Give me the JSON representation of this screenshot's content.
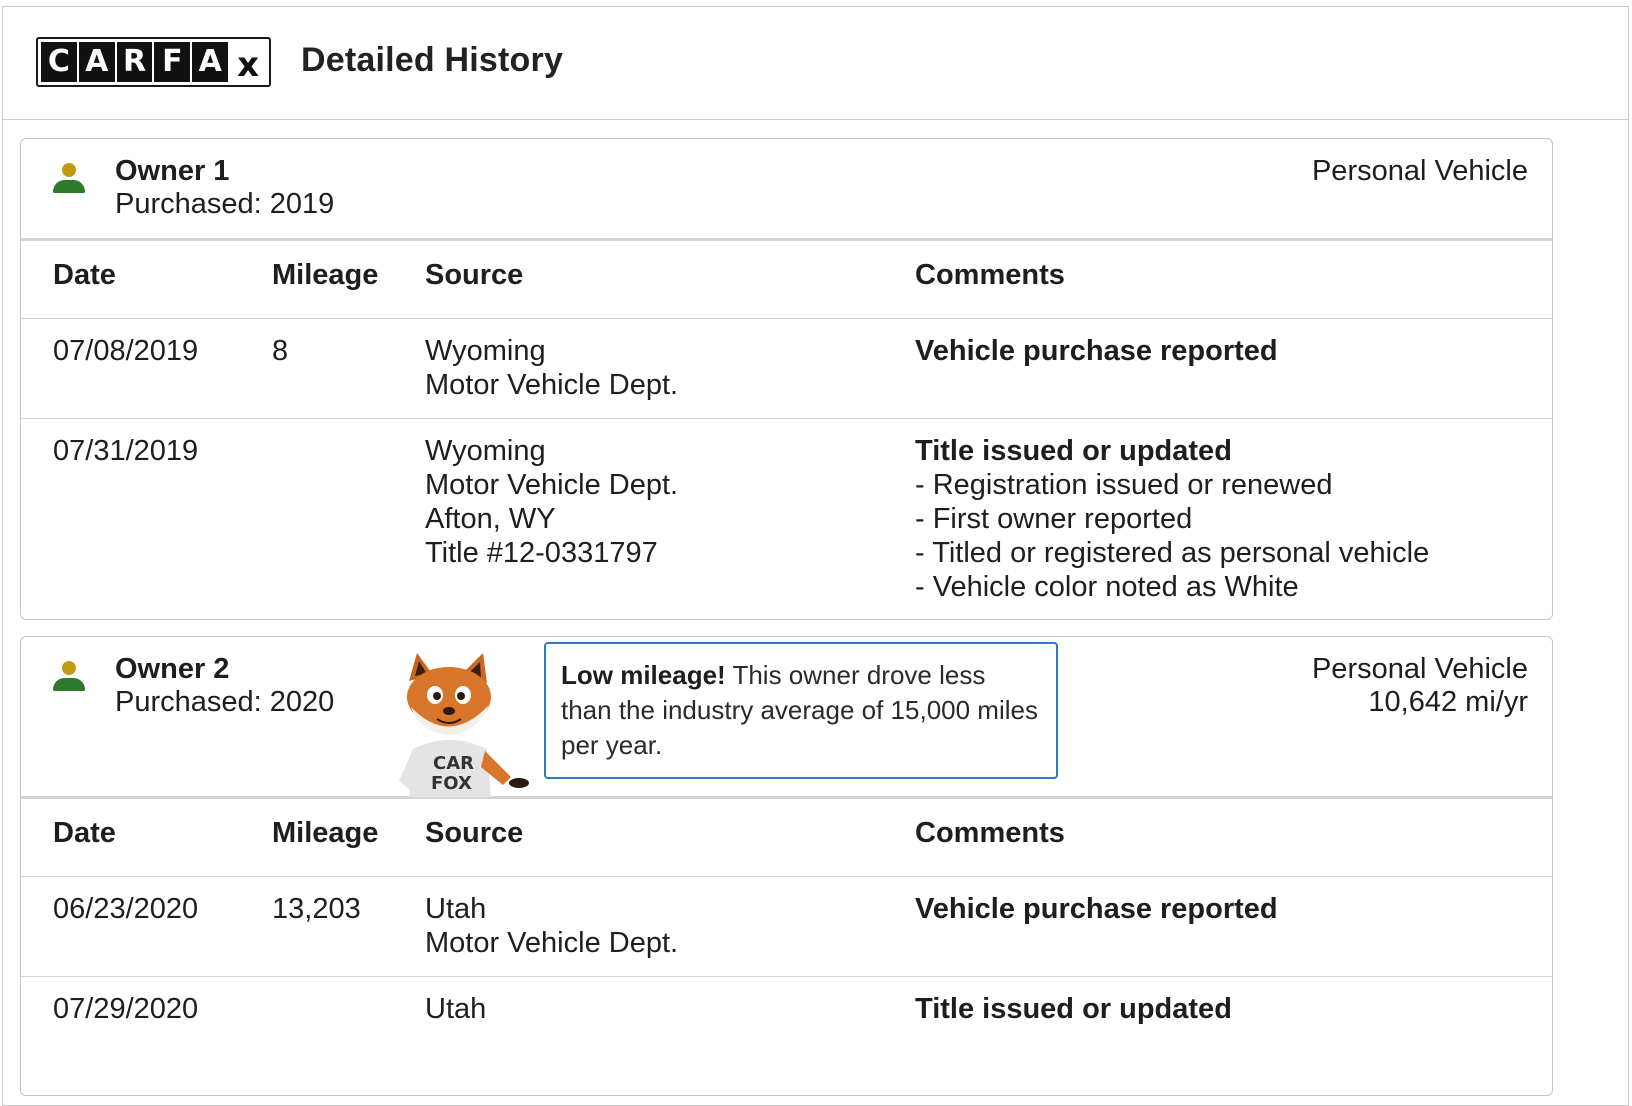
{
  "header": {
    "logo_letters": [
      "C",
      "A",
      "R",
      "F",
      "A",
      "x"
    ],
    "title": "Detailed History"
  },
  "table_headers": {
    "date": "Date",
    "mileage": "Mileage",
    "source": "Source",
    "comments": "Comments"
  },
  "owners": [
    {
      "name": "Owner 1",
      "purchased": "Purchased: 2019",
      "vehicle_type": "Personal Vehicle",
      "rows": [
        {
          "date": "07/08/2019",
          "mileage": "8",
          "source": [
            "Wyoming",
            "Motor Vehicle Dept."
          ],
          "comment_title": "Vehicle purchase reported",
          "comment_items": []
        },
        {
          "date": "07/31/2019",
          "mileage": "",
          "source": [
            "Wyoming",
            "Motor Vehicle Dept.",
            "Afton, WY",
            "Title #12-0331797"
          ],
          "comment_title": "Title issued or updated",
          "comment_items": [
            "- Registration issued or renewed",
            "- First owner reported",
            "- Titled or registered as personal vehicle",
            "- Vehicle color noted as White"
          ]
        }
      ]
    },
    {
      "name": "Owner 2",
      "purchased": "Purchased: 2020",
      "vehicle_type": "Personal Vehicle",
      "miles_per_year": "10,642 mi/yr",
      "callout": {
        "bold": "Low mileage!",
        "text": " This owner drove less than the industry average of 15,000 miles per year."
      },
      "mascot_shirt_text": [
        "CAR",
        "FOX"
      ],
      "rows": [
        {
          "date": "06/23/2020",
          "mileage": "13,203",
          "source": [
            "Utah",
            "Motor Vehicle Dept."
          ],
          "comment_title": "Vehicle purchase reported",
          "comment_items": []
        },
        {
          "date": "07/29/2020",
          "mileage": "",
          "source": [
            "Utah"
          ],
          "comment_title": "Title issued or updated",
          "comment_items": []
        }
      ]
    }
  ],
  "colors": {
    "person_head": "#c19a12",
    "person_body": "#2d7a2d",
    "callout_border": "#2f78c9",
    "border": "#c9c9c9"
  }
}
